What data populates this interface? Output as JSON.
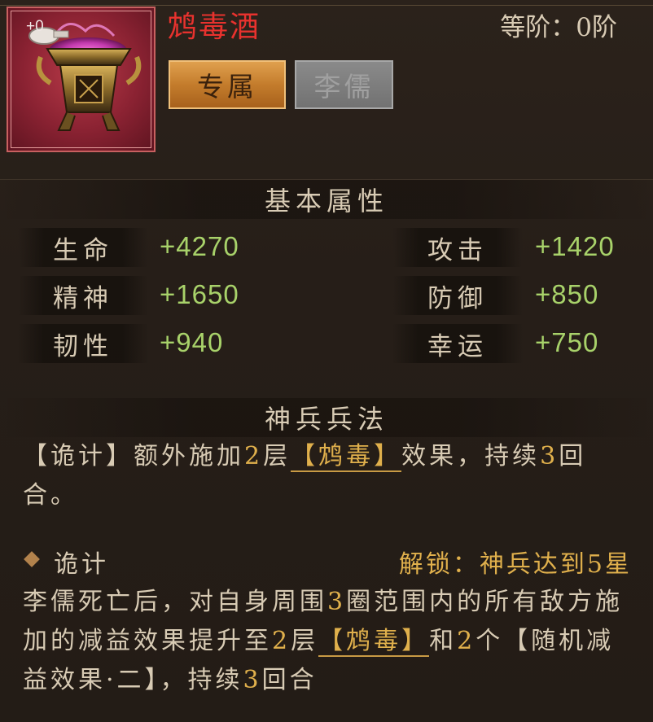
{
  "item": {
    "name": "鸩毒酒",
    "enhance_level": "+0",
    "tier_label": "等阶：",
    "tier_value": "0阶"
  },
  "buttons": {
    "exclusive": "专属",
    "hero": "李儒"
  },
  "basic_attributes": {
    "title": "基本属性",
    "stats": [
      {
        "label": "生命",
        "value": "+4270"
      },
      {
        "label": "攻击",
        "value": "+1420"
      },
      {
        "label": "精神",
        "value": "+1650"
      },
      {
        "label": "防御",
        "value": "+850"
      },
      {
        "label": "韧性",
        "value": "+940"
      },
      {
        "label": "幸运",
        "value": "+750"
      }
    ]
  },
  "tactics": {
    "title": "神兵兵法",
    "desc": {
      "p1": "【诡计】额外施加",
      "n1": "2",
      "p2": "层",
      "tag1": "【鸩毒】",
      "p3": "效果，持续",
      "n2": "3",
      "p4": "回合。"
    },
    "skill": {
      "name": "诡计",
      "unlock": "解锁：神兵达到5星"
    },
    "skill_desc": {
      "p1": "李儒死亡后，对自身周围",
      "n1": "3",
      "p2": "圈范围内的所有敌方施加的减益效果提升至",
      "n2": "2",
      "p3": "层",
      "tag1": "【鸩毒】",
      "p4": "和",
      "n3": "2",
      "p5": "个【随机减益效果·二】，持续",
      "n4": "3",
      "p6": "回合"
    }
  },
  "colors": {
    "name_red": "#e8322e",
    "stat_green": "#a8d26a",
    "highlight_gold": "#e0b04c"
  }
}
